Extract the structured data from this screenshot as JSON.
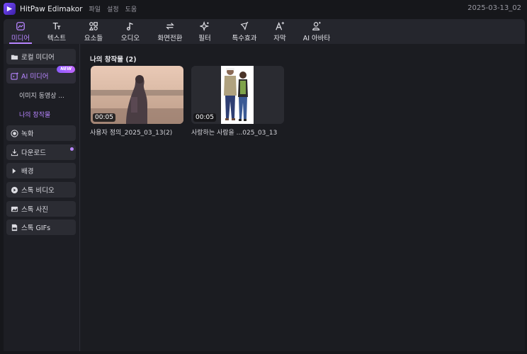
{
  "app": {
    "title": "HitPaw Edimakor",
    "menus": [
      "파일",
      "설정",
      "도움"
    ],
    "date": "2025-03-13_02"
  },
  "toolbar": {
    "tabs": [
      {
        "label": "미디어",
        "icon": "media-icon",
        "active": true
      },
      {
        "label": "텍스트",
        "icon": "text-icon"
      },
      {
        "label": "요소들",
        "icon": "elements-icon"
      },
      {
        "label": "오디오",
        "icon": "audio-note-icon"
      },
      {
        "label": "화면전환",
        "icon": "transition-arrows-icon"
      },
      {
        "label": "필터",
        "icon": "filter-sparkle-icon"
      },
      {
        "label": "특수효과",
        "icon": "effects-icon"
      },
      {
        "label": "자막",
        "icon": "subtitle-icon"
      },
      {
        "label": "AI 아바타",
        "icon": "avatar-icon"
      }
    ]
  },
  "sidebar": {
    "local_media": "로컬 미디어",
    "ai_media": "AI 미디어",
    "new_badge": "NEW",
    "sub_image_video": "이미지 동영상 ...",
    "sub_my_creations": "나의 창작물",
    "record": "녹화",
    "download": "다운로드",
    "background": "배경",
    "stock_video": "스톡 비디오",
    "stock_photo": "스톡 사진",
    "stock_gifs": "스톡 GIFs"
  },
  "content": {
    "section_title": "나의 창작물 (2)",
    "items": [
      {
        "duration": "00:05",
        "name": "사용자 정의_2025_03_13(2)"
      },
      {
        "duration": "00:05",
        "name": "사랑하는 사람을 ...025_03_13"
      }
    ]
  },
  "colors": {
    "accent": "#b785ff",
    "background": "#16171b",
    "panel": "#25262d"
  }
}
